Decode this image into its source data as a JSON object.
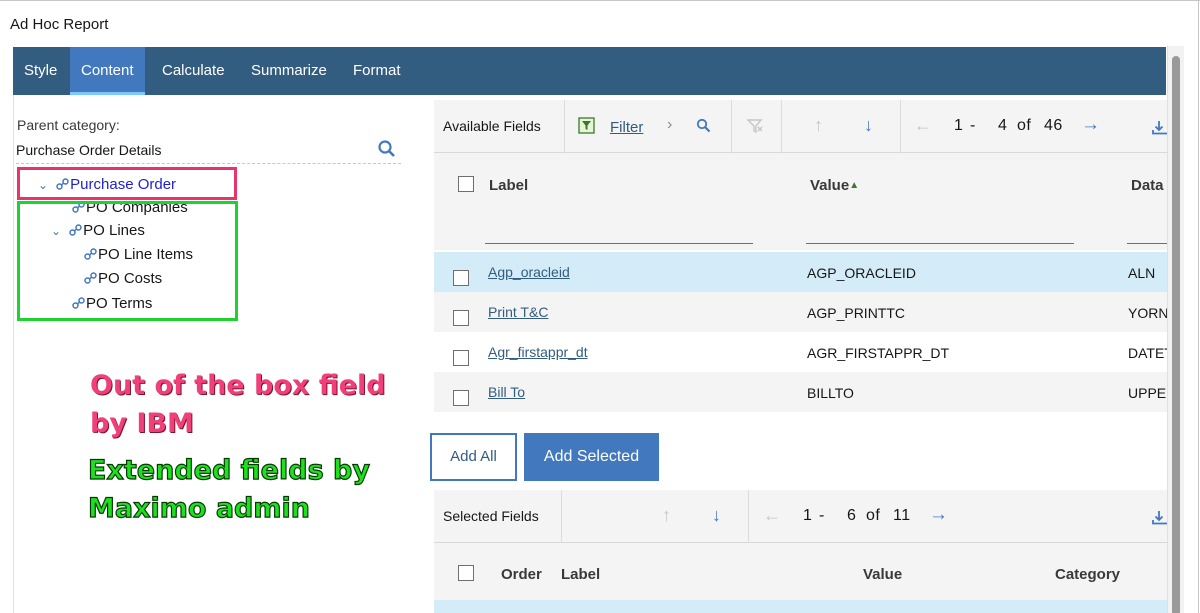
{
  "window": {
    "title": "Ad Hoc Report"
  },
  "tabs": [
    {
      "label": "Style",
      "active": false
    },
    {
      "label": "Content",
      "active": true
    },
    {
      "label": "Calculate",
      "active": false
    },
    {
      "label": "Summarize",
      "active": false
    },
    {
      "label": "Format",
      "active": false
    }
  ],
  "left_panel": {
    "parent_category_label": "Parent category:",
    "parent_category_value": "Purchase Order Details",
    "tree": [
      {
        "label": "Purchase Order",
        "expanded": true,
        "highlighted": true
      },
      {
        "label": "PO Companies",
        "expanded": false
      },
      {
        "label": "PO Lines",
        "expanded": true
      },
      {
        "label": "PO Line Items",
        "expanded": false
      },
      {
        "label": "PO Costs",
        "expanded": false
      },
      {
        "label": "PO Terms",
        "expanded": false
      }
    ]
  },
  "annotations": {
    "pink_line1": "Out of the box field",
    "pink_line2": "by IBM",
    "green_line1": "Extended fields by",
    "green_line2": "Maximo admin",
    "pink_color": "#e8336d",
    "green_color": "#1fd22f"
  },
  "available_fields": {
    "title": "Available Fields",
    "filter_label": "Filter",
    "page_start": "1",
    "page_range_sep": "-",
    "page_end": "4",
    "page_of": "of",
    "page_total": "46",
    "columns": {
      "label": "Label",
      "value": "Value",
      "type": "Data"
    },
    "rows": [
      {
        "label": "Agp_oracleid",
        "value": "AGP_ORACLEID",
        "type": "ALN",
        "selected_row": true
      },
      {
        "label": "Print T&C",
        "value": "AGP_PRINTTC",
        "type": "YORN",
        "selected_row": false
      },
      {
        "label": "Agr_firstappr_dt",
        "value": "AGR_FIRSTAPPR_DT",
        "type": "DATETIME",
        "selected_row": false
      },
      {
        "label": "Bill To",
        "value": "BILLTO",
        "type": "UPPER",
        "selected_row": false
      }
    ]
  },
  "buttons": {
    "add_all": "Add All",
    "add_selected": "Add Selected"
  },
  "selected_fields": {
    "title": "Selected Fields",
    "page_start": "1",
    "page_range_sep": "-",
    "page_end": "6",
    "page_of": "of",
    "page_total": "11",
    "columns": {
      "order": "Order",
      "label": "Label",
      "value": "Value",
      "category": "Category"
    }
  },
  "colors": {
    "tabbar": "#325c80",
    "tab_active": "#4178be",
    "link": "#325c80",
    "primary_button": "#4178be",
    "row_highlight": "#d4ecf7"
  }
}
